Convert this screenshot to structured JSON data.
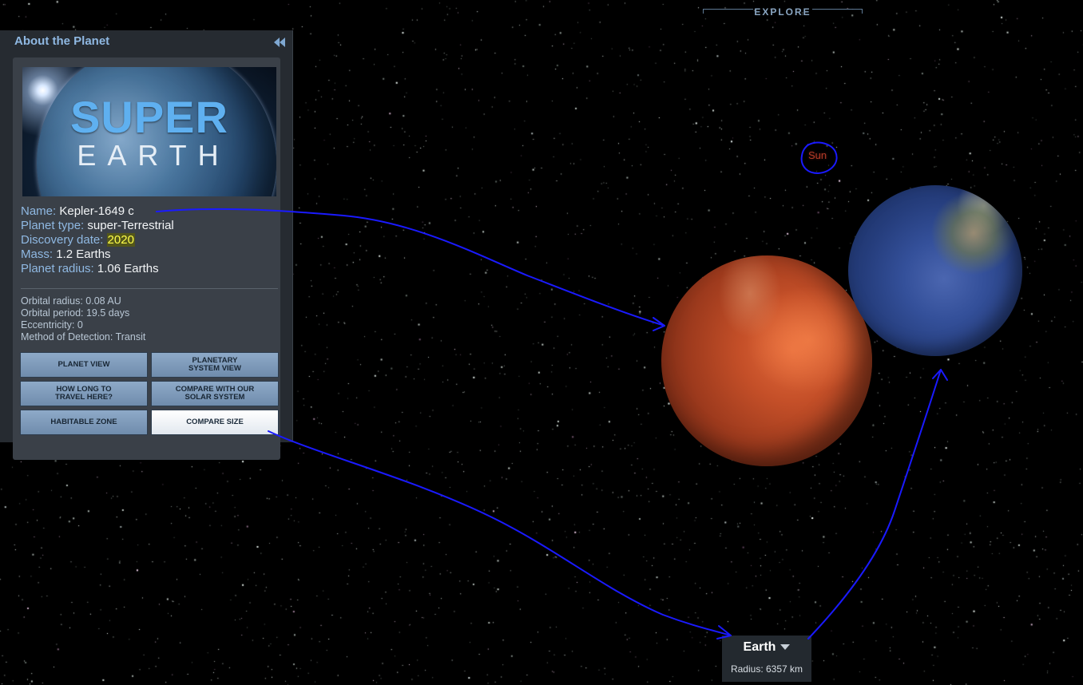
{
  "explore": {
    "label": "EXPLORE"
  },
  "panel": {
    "title": "About the Planet",
    "image": {
      "line1": "SUPER",
      "line2": "EARTH"
    },
    "facts": [
      {
        "label": "Name:",
        "value": "Kepler-1649 c"
      },
      {
        "label": "Planet type:",
        "value": "super-Terrestrial"
      },
      {
        "label": "Discovery date:",
        "value": "2020"
      },
      {
        "label": "Mass:",
        "value": "1.2 Earths"
      },
      {
        "label": "Planet radius:",
        "value": "1.06 Earths"
      }
    ],
    "orbit": [
      "Orbital radius: 0.08 AU",
      "Orbital period: 19.5 days",
      "Eccentricity: 0",
      "Method of Detection: Transit"
    ],
    "buttons": [
      {
        "label": "PLANET VIEW"
      },
      {
        "label": "PLANETARY\nSYSTEM VIEW"
      },
      {
        "label": "HOW LONG TO\nTRAVEL HERE?"
      },
      {
        "label": "COMPARE WITH OUR\nSOLAR SYSTEM"
      },
      {
        "label": "HABITABLE ZONE"
      },
      {
        "label": "COMPARE SIZE"
      }
    ]
  },
  "scene": {
    "sun_label": "Sun",
    "compare": {
      "selected": "Earth",
      "radius": "Radius: 6357 km"
    }
  },
  "colors": {
    "accent": "#8fb8e2",
    "highlight": "#ffff4a",
    "annotation": "#1a1aff"
  }
}
